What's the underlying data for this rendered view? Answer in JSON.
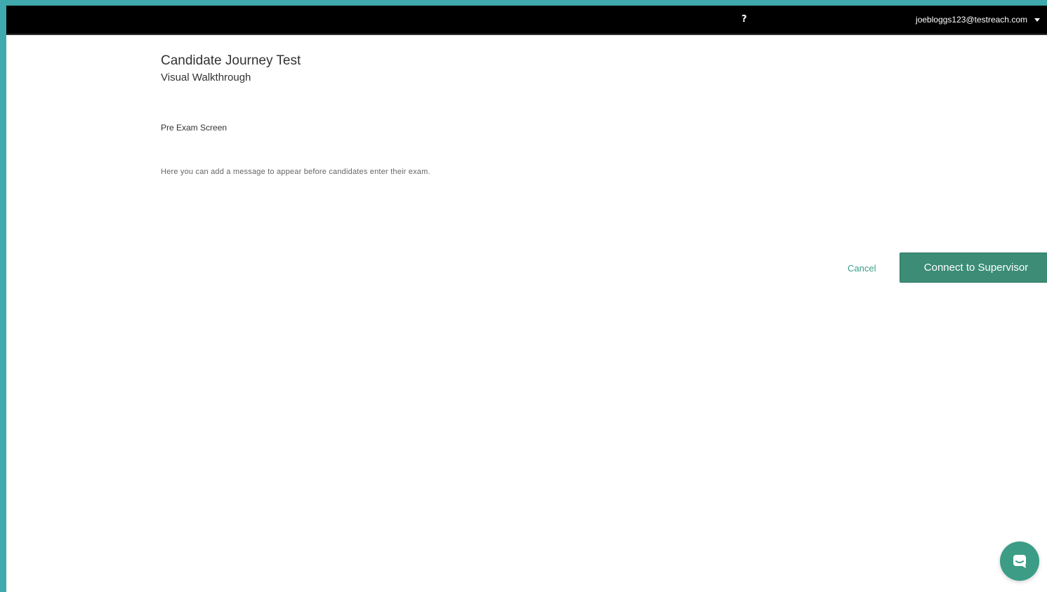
{
  "header": {
    "help_label": "?",
    "user_email": "joebloggs123@testreach.com"
  },
  "main": {
    "title": "Candidate Journey Test",
    "subtitle": "Visual Walkthrough",
    "section_heading": "Pre Exam Screen",
    "message": "Here you can add a message to appear before candidates enter their exam.",
    "cancel_label": "Cancel",
    "primary_button_label": "Connect to Supervisor"
  },
  "icons": {
    "help": "help-icon",
    "caret": "chevron-down-icon",
    "chat": "chat-icon"
  },
  "colors": {
    "frame": "#3fa9ad",
    "topbar": "#000000",
    "accent": "#3c8c76",
    "link": "#3c9c86"
  }
}
